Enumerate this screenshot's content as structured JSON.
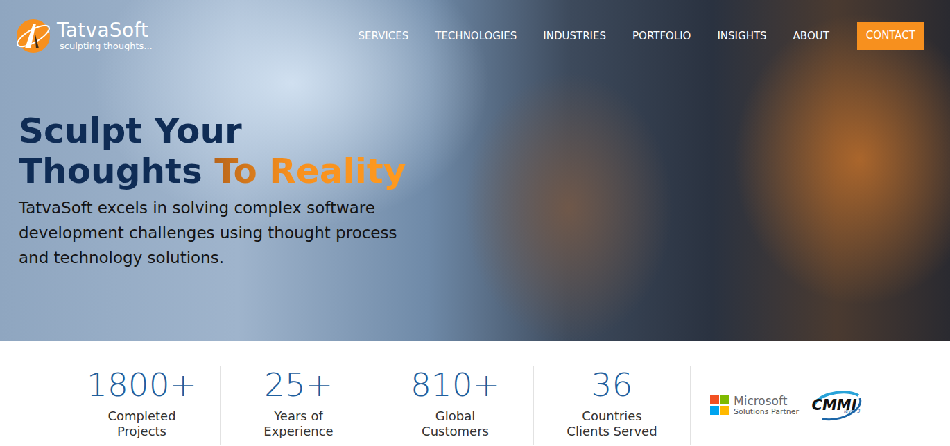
{
  "logo": {
    "name": "TatvaSoft",
    "tagline": "sculpting thoughts..."
  },
  "nav": [
    {
      "label": "SERVICES"
    },
    {
      "label": "TECHNOLOGIES"
    },
    {
      "label": "INDUSTRIES"
    },
    {
      "label": "PORTFOLIO"
    },
    {
      "label": "INSIGHTS"
    },
    {
      "label": "ABOUT"
    }
  ],
  "contact_button": "CONTACT",
  "hero": {
    "title_line1": "Sculpt Your",
    "title_line2": "Thoughts",
    "title_accent": "To Reality",
    "description": "TatvaSoft excels in solving complex software development challenges using thought process and technology solutions."
  },
  "stats": [
    {
      "value": "1800+",
      "label": [
        "Completed",
        "Projects"
      ]
    },
    {
      "value": "25+",
      "label": [
        "Years of",
        "Experience"
      ]
    },
    {
      "value": "810+",
      "label": [
        "Global",
        "Customers"
      ]
    },
    {
      "value": "36",
      "label": [
        "Countries",
        "Clients Served"
      ]
    }
  ],
  "badges": {
    "microsoft": {
      "name": "Microsoft",
      "subtitle": "Solutions Partner"
    },
    "cmmi": {
      "name": "CMMI",
      "level": "level 3"
    }
  }
}
